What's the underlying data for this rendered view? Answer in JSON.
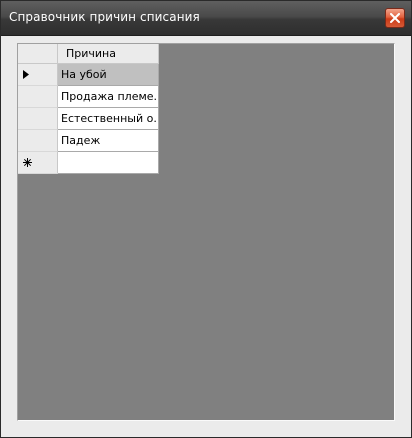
{
  "window": {
    "title": "Справочник причин списания"
  },
  "grid": {
    "column_header": "Причина",
    "rows": [
      {
        "value": "На убой",
        "selected": true
      },
      {
        "value": "Продажа племе..."
      },
      {
        "value": "Естественный о..."
      },
      {
        "value": "Падеж"
      }
    ],
    "new_row_value": ""
  },
  "colors": {
    "titlebar": "#3a3a3a",
    "client_background": "#808080",
    "close_button": "#d9532f"
  },
  "icons": {
    "current_row": "triangle-right-icon",
    "new_row": "asterisk-icon",
    "close": "close-icon"
  }
}
